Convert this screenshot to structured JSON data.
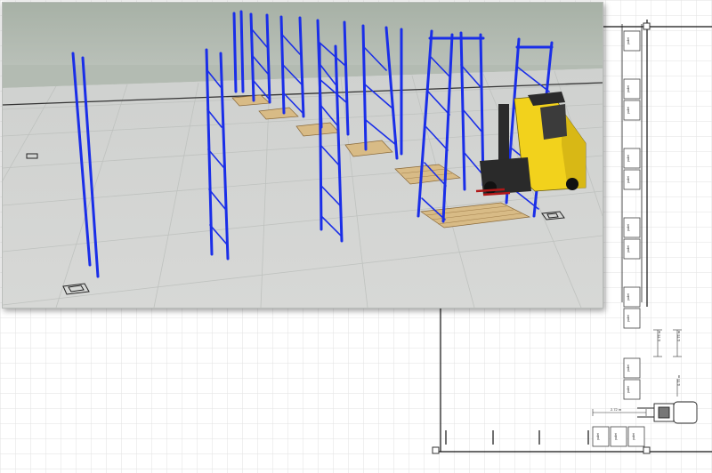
{
  "viewport": {
    "name": "3d-warehouse-view",
    "colors": {
      "sky": "#a9b3a9",
      "floor": "#d5d6d4",
      "grid": "#bfc1bf",
      "rack": "#1a2ee8",
      "pallet": "#d8bb86",
      "forklift": "#f2d21c"
    }
  },
  "plan": {
    "labels": {
      "pallet": "pallet",
      "dim_1": "0.75 m",
      "dim_2": "0.75 m",
      "dim_3": "2.72 m",
      "dim_4": "0.75 m"
    }
  }
}
